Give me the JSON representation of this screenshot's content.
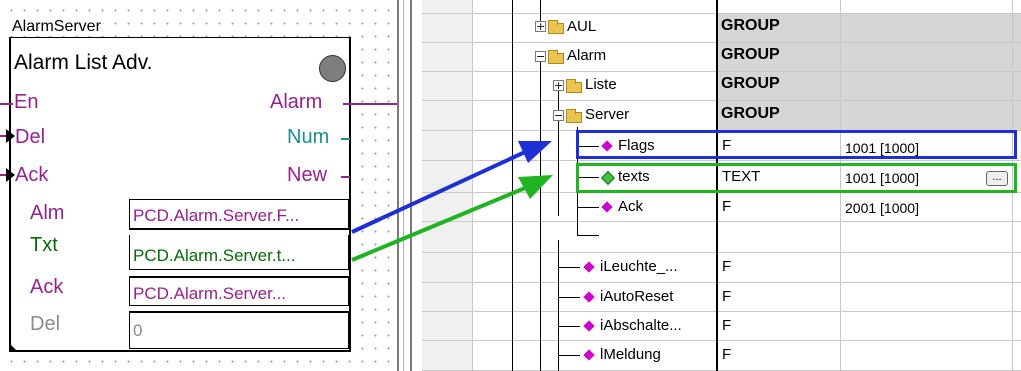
{
  "function_block": {
    "instance_name": "AlarmServer",
    "block_name": "Alarm List Adv.",
    "inputs": [
      "En",
      "Del",
      "Ack"
    ],
    "outputs": [
      "Alarm",
      "Num",
      "New"
    ],
    "params": [
      {
        "label": "Alm",
        "value": "PCD.Alarm.Server.F..."
      },
      {
        "label": "Txt",
        "value": "PCD.Alarm.Server.t..."
      },
      {
        "label": "Ack",
        "value": "PCD.Alarm.Server..."
      },
      {
        "label": "Del",
        "value": "0"
      }
    ]
  },
  "symbol_tree": {
    "rows": [
      {
        "name": "AUL",
        "type": "GROUP",
        "value": ""
      },
      {
        "name": "Alarm",
        "type": "GROUP",
        "value": ""
      },
      {
        "name": "Liste",
        "type": "GROUP",
        "value": ""
      },
      {
        "name": "Server",
        "type": "GROUP",
        "value": ""
      },
      {
        "name": "Flags",
        "type": "F",
        "value": "1001 [1000]"
      },
      {
        "name": "texts",
        "type": "TEXT",
        "value": "1001 [1000]",
        "button": "..."
      },
      {
        "name": "Ack",
        "type": "F",
        "value": "2001 [1000]"
      },
      {
        "name": "",
        "type": "",
        "value": ""
      },
      {
        "name": "iLeuchte_...",
        "type": "F",
        "value": ""
      },
      {
        "name": "iAutoReset",
        "type": "F",
        "value": ""
      },
      {
        "name": "iAbschalte...",
        "type": "F",
        "value": ""
      },
      {
        "name": "lMeldung",
        "type": "F",
        "value": ""
      }
    ]
  },
  "colors": {
    "highlight_blue": "#1f2fd6",
    "highlight_green": "#22b322",
    "group_fill": "#d6d6d6",
    "pin_purple": "#93238d",
    "pin_teal": "#1c8e8f",
    "diamond_magenta": "#cc00cc",
    "diamond_green": "#40c040"
  }
}
